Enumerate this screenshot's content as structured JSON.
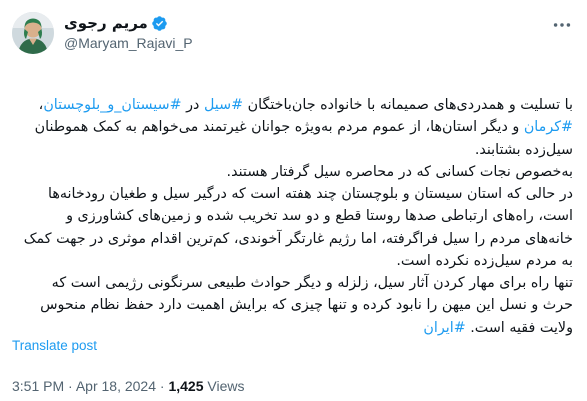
{
  "author": {
    "name": "مریم رجوی",
    "handle": "@Maryam_Rajavi_P",
    "verified": true,
    "avatar_icon": "profile-photo",
    "verified_icon": "verified-badge-icon",
    "verified_color": "#1d9bf0"
  },
  "more_icon": "more-options-icon",
  "tweet": {
    "paragraphs": [
      [
        {
          "t": "با تسلیت و همدردی‌های صمیمانه با خانواده جان‌باختگان "
        },
        {
          "t": "#سیل",
          "tag": true
        },
        {
          "t": " در "
        },
        {
          "t": "#سیستان_و_بلوچستان",
          "tag": true
        },
        {
          "t": "، "
        },
        {
          "t": "#کرمان",
          "tag": true
        },
        {
          "t": " و دیگر استان‌ها، از عموم مردم به‌ویژه جوانان غیرتمند می‌خواهم به کمک هموطنان سیل‌زده بشتابند."
        }
      ],
      [
        {
          "t": "به‌خصوص نجات کسانی که در محاصره سیل گرفتار هستند."
        }
      ],
      [
        {
          "t": "در حالی که استان سیستان و بلوچستان چند هفته است که درگیر سیل و طغیان رودخانه‌ها است، راه‌های ارتباطی صدها روستا قطع و دو سد تخریب شده و زمین‌های کشاورزی و خانه‌های مردم را سیل فراگرفته، اما رژیم غارتگر آخوندی، کم‌ترین اقدام موثری در جهت کمک به مردم سیل‌زده نکرده است."
        }
      ],
      [
        {
          "t": "تنها راه برای مهار کردن آثار سیل، زلزله و دیگر حوادث طبیعی سرنگونی رژیمی است که حرث و نسل این میهن را نابود کرده و تنها چیزی که برایش اهمیت دارد حفظ نظام منحوس ولایت فقیه است. "
        },
        {
          "t": "#ایران",
          "tag": true
        }
      ]
    ]
  },
  "translate_label": "Translate post",
  "meta": {
    "time": "3:51 PM",
    "separator": "·",
    "date": "Apr 18, 2024",
    "views_count": "1,425",
    "views_label": "Views"
  },
  "colors": {
    "link": "#1d9bf0",
    "secondary_text": "#536471",
    "primary_text": "#0f1419"
  }
}
